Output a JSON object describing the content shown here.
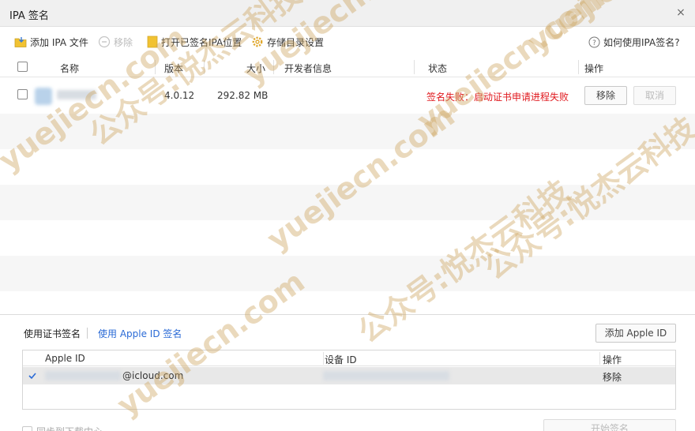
{
  "window": {
    "title": "IPA 签名",
    "close_glyph": "×"
  },
  "toolbar": {
    "add_ipa": "添加 IPA 文件",
    "remove": "移除",
    "open_location": "打开已签名IPA位置",
    "storage_settings": "存储目录设置",
    "help": "如何使用IPA签名?"
  },
  "table": {
    "columns": {
      "name": "名称",
      "version": "版本",
      "size": "大小",
      "developer": "开发者信息",
      "status": "状态",
      "actions": "操作"
    },
    "rows": [
      {
        "version": "4.0.12",
        "size": "292.82 MB",
        "status": "签名失败：启动证书申请进程失败",
        "remove": "移除",
        "cancel": "取消"
      }
    ]
  },
  "tabs": {
    "cert": "使用证书签名",
    "apple_id": "使用 Apple ID 签名",
    "add_apple_id": "添加 Apple ID"
  },
  "apple_table": {
    "columns": {
      "apple_id": "Apple ID",
      "device_id": "设备 ID",
      "actions": "操作"
    },
    "rows": [
      {
        "apple_id_suffix": "@icloud.com",
        "remove": "移除"
      }
    ]
  },
  "bottom": {
    "sync_label": "同步到下载中心",
    "start_button": "开始签名"
  },
  "watermarks": [
    "公众号:悦杰云科技",
    "yuejiecn.com"
  ],
  "colors": {
    "error_text": "#e0191e",
    "link": "#2a6ad6",
    "folder": "#f1c232"
  }
}
